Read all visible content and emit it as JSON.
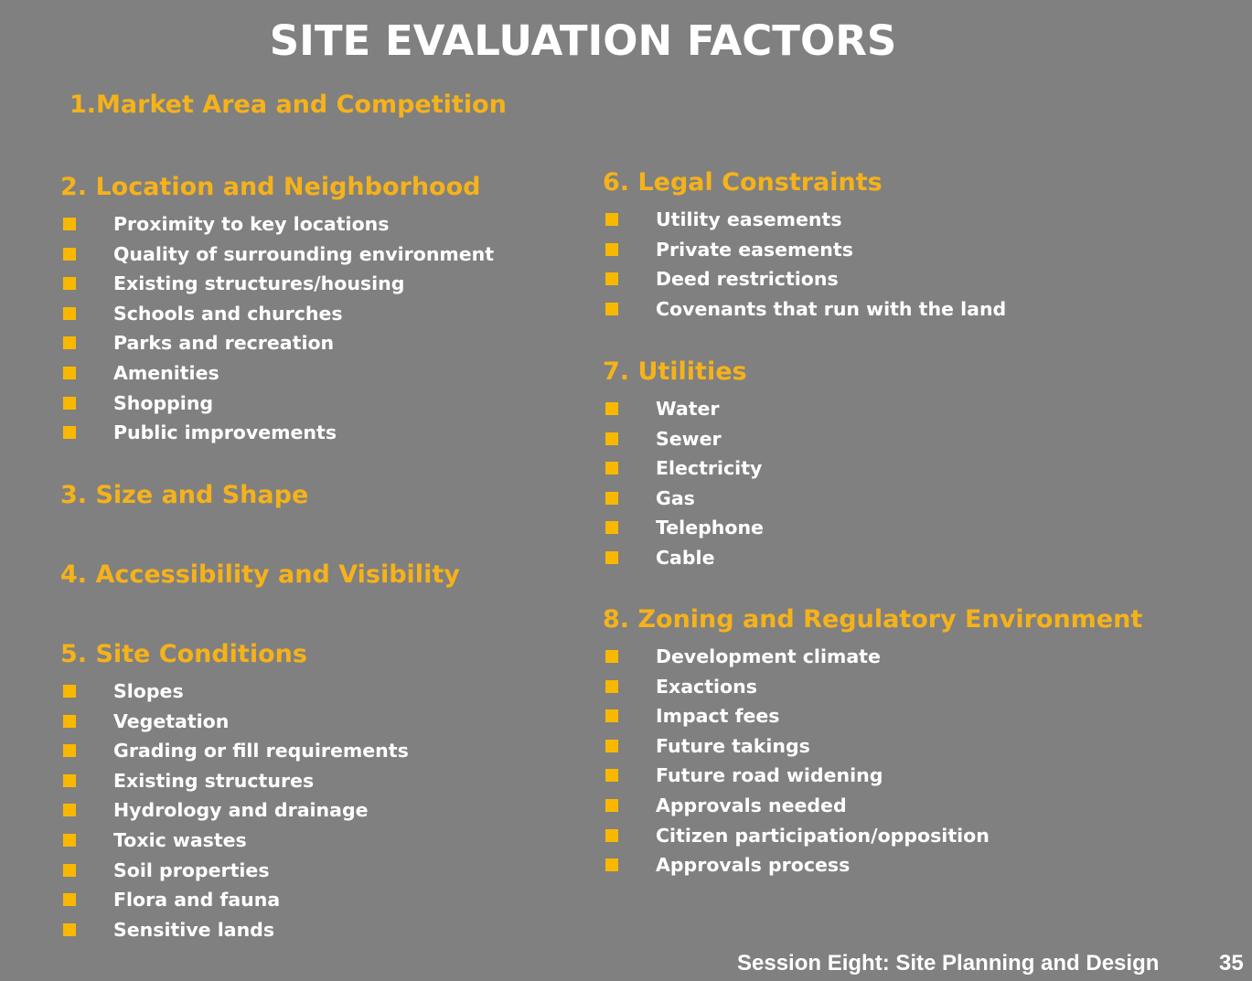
{
  "title": "SITE EVALUATION FACTORS",
  "colors": {
    "background": "#808080",
    "heading": "#f5b21a",
    "bullet": "#f9b800",
    "text": "#ffffff"
  },
  "sections": {
    "s1": {
      "heading": "1.Market Area and Competition"
    },
    "s2": {
      "heading": "2. Location and Neighborhood",
      "items": [
        "Proximity to key locations",
        "Quality of surrounding environment",
        "Existing structures/housing",
        "Schools and churches",
        "Parks and recreation",
        "Amenities",
        "Shopping",
        "Public improvements"
      ]
    },
    "s3": {
      "heading": "3. Size and Shape"
    },
    "s4": {
      "heading": "4. Accessibility and Visibility"
    },
    "s5": {
      "heading": "5. Site Conditions",
      "items": [
        "Slopes",
        "Vegetation",
        "Grading or fill requirements",
        "Existing structures",
        "Hydrology and drainage",
        "Toxic wastes",
        "Soil properties",
        "Flora and fauna",
        "Sensitive lands"
      ]
    },
    "s6": {
      "heading": "6. Legal Constraints",
      "items": [
        "Utility easements",
        "Private easements",
        "Deed restrictions",
        "Covenants that run with the land"
      ]
    },
    "s7": {
      "heading": "7. Utilities",
      "items": [
        "Water",
        "Sewer",
        "Electricity",
        "Gas",
        "Telephone",
        "Cable"
      ]
    },
    "s8": {
      "heading": "8. Zoning and Regulatory Environment",
      "items": [
        "Development climate",
        "Exactions",
        "Impact fees",
        "Future takings",
        "Future road widening",
        "Approvals needed",
        "Citizen participation/opposition",
        "Approvals process"
      ]
    }
  },
  "footer": {
    "session": "Session Eight: Site Planning and Design",
    "page": "35"
  }
}
